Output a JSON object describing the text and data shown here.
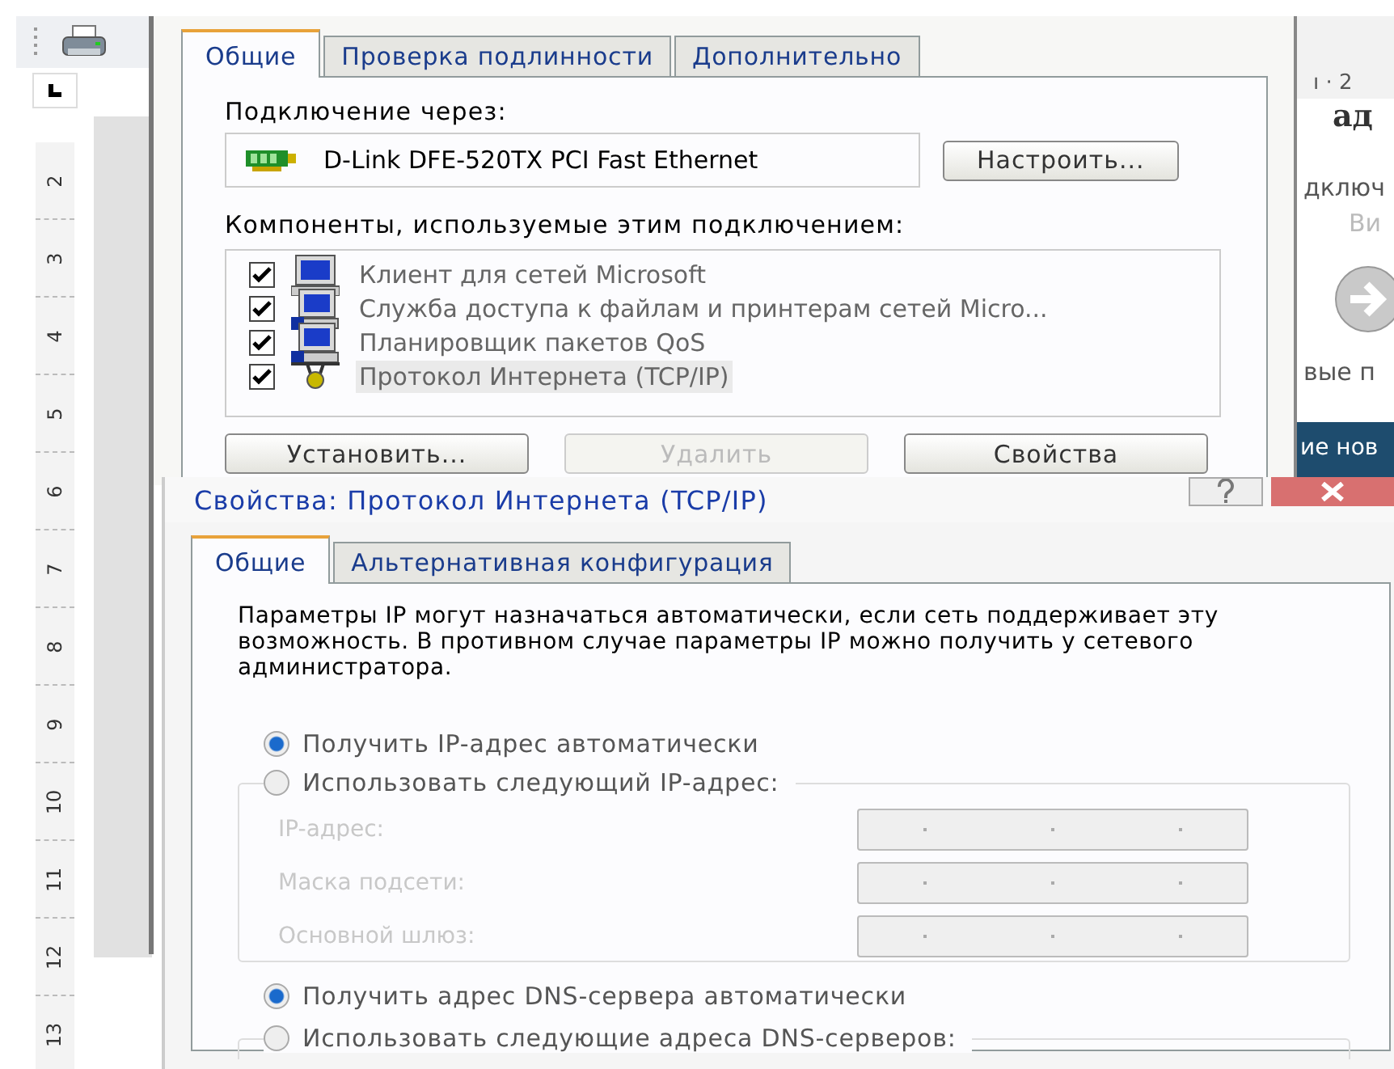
{
  "editor": {
    "ruler_numbers": [
      "2",
      "3",
      "4",
      "5",
      "6",
      "7",
      "8",
      "9",
      "10",
      "11",
      "12",
      "13"
    ],
    "top_ruler": "ı · 2",
    "page_fragments": [
      {
        "text": "ад",
        "kind": "heading"
      },
      {
        "text": "дключ",
        "kind": "normal"
      },
      {
        "text": "Ви",
        "kind": "muted"
      },
      {
        "text": "вые п",
        "kind": "normal"
      }
    ],
    "banner": "ие нов"
  },
  "connection_dialog": {
    "tabs": [
      {
        "label": "Общие",
        "selected": true
      },
      {
        "label": "Проверка подлинности",
        "selected": false
      },
      {
        "label": "Дополнительно",
        "selected": false
      }
    ],
    "connect_label": "Подключение через:",
    "adapter": "D-Link DFE-520TX PCI Fast Ethernet",
    "configure_button": "Настроить...",
    "components_label": "Компоненты, используемые этим подключением:",
    "components": [
      {
        "label": "Клиент для сетей Microsoft",
        "checked": true,
        "selected": false,
        "kind": "client"
      },
      {
        "label": "Служба доступа к файлам и принтерам сетей Micro...",
        "checked": true,
        "selected": false,
        "kind": "service"
      },
      {
        "label": "Планировщик пакетов QoS",
        "checked": true,
        "selected": false,
        "kind": "service"
      },
      {
        "label": "Протокол Интернета (TCP/IP)",
        "checked": true,
        "selected": true,
        "kind": "protocol"
      }
    ],
    "buttons": [
      {
        "label": "Установить...",
        "disabled": false
      },
      {
        "label": "Удалить",
        "disabled": true
      },
      {
        "label": "Свойства",
        "disabled": false
      }
    ]
  },
  "tcp_dialog": {
    "title": "Свойства: Протокол Интернета (TCP/IP)",
    "tabs": [
      {
        "label": "Общие",
        "selected": true
      },
      {
        "label": "Альтернативная конфигурация",
        "selected": false
      }
    ],
    "description": "Параметры IP могут назначаться автоматически, если сеть поддерживает эту возможность. В противном случае параметры IP можно получить у сетевого администратора.",
    "ip_auto": {
      "label": "Получить IP-адрес автоматически",
      "selected": true
    },
    "ip_manual": {
      "label": "Использовать следующий IP-адрес:",
      "selected": false
    },
    "ip_fields": [
      {
        "label": "IP-адрес:",
        "disabled": true
      },
      {
        "label": "Маска подсети:",
        "disabled": true
      },
      {
        "label": "Основной шлюз:",
        "disabled": true
      }
    ],
    "dns_auto": {
      "label": "Получить адрес DNS-сервера автоматически",
      "selected": true
    },
    "dns_manual": {
      "label": "Использовать следующие адреса DNS-серверов:",
      "selected": false
    }
  }
}
